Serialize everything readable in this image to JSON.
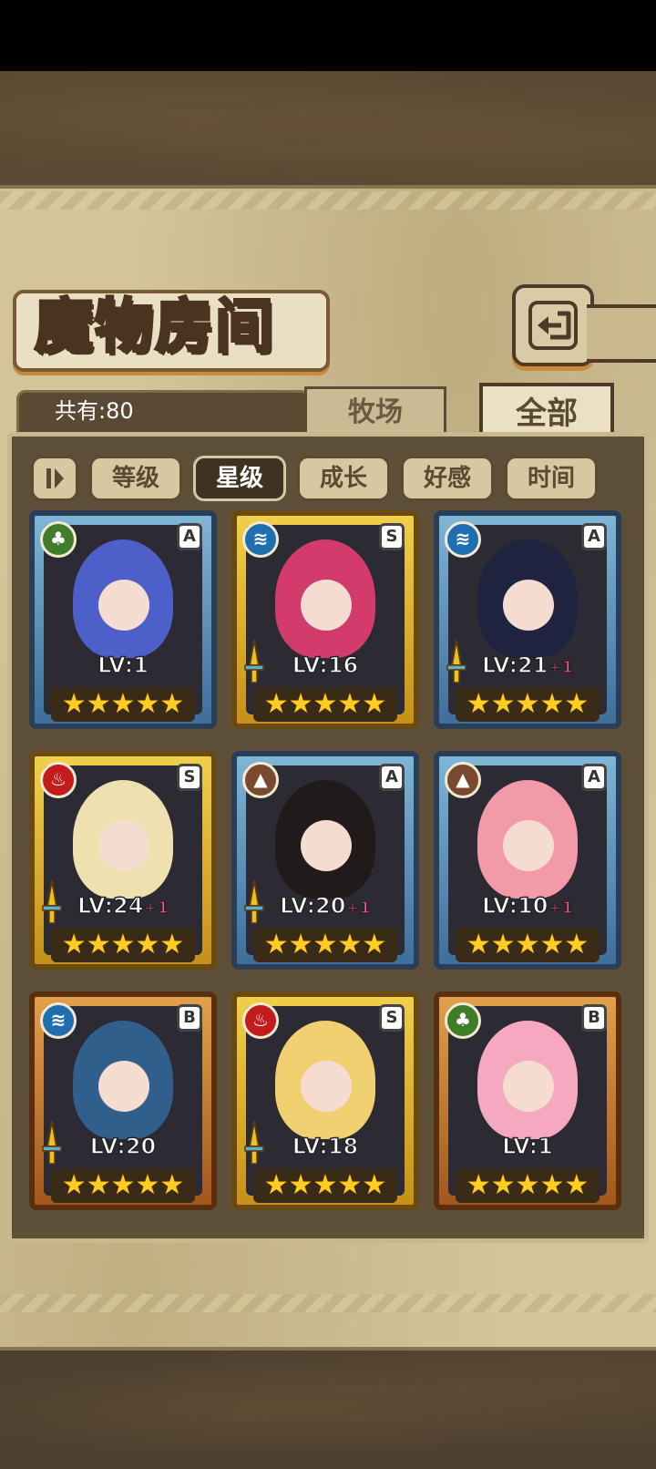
{
  "title": "魔物房间",
  "count_label": "共有:80",
  "tabs": {
    "farm": "牧场",
    "all": "全部"
  },
  "sort": {
    "toggle_icon": "sort-toggle-icon",
    "buttons": [
      "等级",
      "星级",
      "成长",
      "好感",
      "时间"
    ],
    "active": "星级"
  },
  "cards": [
    {
      "element": "wood",
      "rank": "A",
      "lv": "LV:1",
      "plus": "",
      "frame": "blue",
      "has_sword": false,
      "hair": "#4d5fc8",
      "stars": 5
    },
    {
      "element": "water",
      "rank": "S",
      "lv": "LV:16",
      "plus": "",
      "frame": "gold",
      "has_sword": true,
      "hair": "#d23b6b",
      "stars": 5
    },
    {
      "element": "water",
      "rank": "A",
      "lv": "LV:21",
      "plus": "+1",
      "frame": "blue",
      "has_sword": true,
      "hair": "#1e2340",
      "stars": 5
    },
    {
      "element": "fire",
      "rank": "S",
      "lv": "LV:24",
      "plus": "+1",
      "frame": "gold",
      "has_sword": true,
      "hair": "#efe0b0",
      "stars": 5
    },
    {
      "element": "earth",
      "rank": "A",
      "lv": "LV:20",
      "plus": "+1",
      "frame": "blue",
      "has_sword": true,
      "hair": "#201a1a",
      "stars": 5
    },
    {
      "element": "earth",
      "rank": "A",
      "lv": "LV:10",
      "plus": "+1",
      "frame": "blue",
      "has_sword": false,
      "hair": "#f29aa8",
      "stars": 5
    },
    {
      "element": "water",
      "rank": "B",
      "lv": "LV:20",
      "plus": "",
      "frame": "bronze",
      "has_sword": true,
      "hair": "#2f5f8a",
      "stars": 5
    },
    {
      "element": "fire",
      "rank": "S",
      "lv": "LV:18",
      "plus": "",
      "frame": "gold",
      "has_sword": true,
      "hair": "#f0d070",
      "stars": 5
    },
    {
      "element": "wood",
      "rank": "B",
      "lv": "LV:1",
      "plus": "",
      "frame": "bronze",
      "has_sword": false,
      "hair": "#f5a8c0",
      "stars": 5
    }
  ],
  "icons": {
    "back": "back-icon"
  }
}
